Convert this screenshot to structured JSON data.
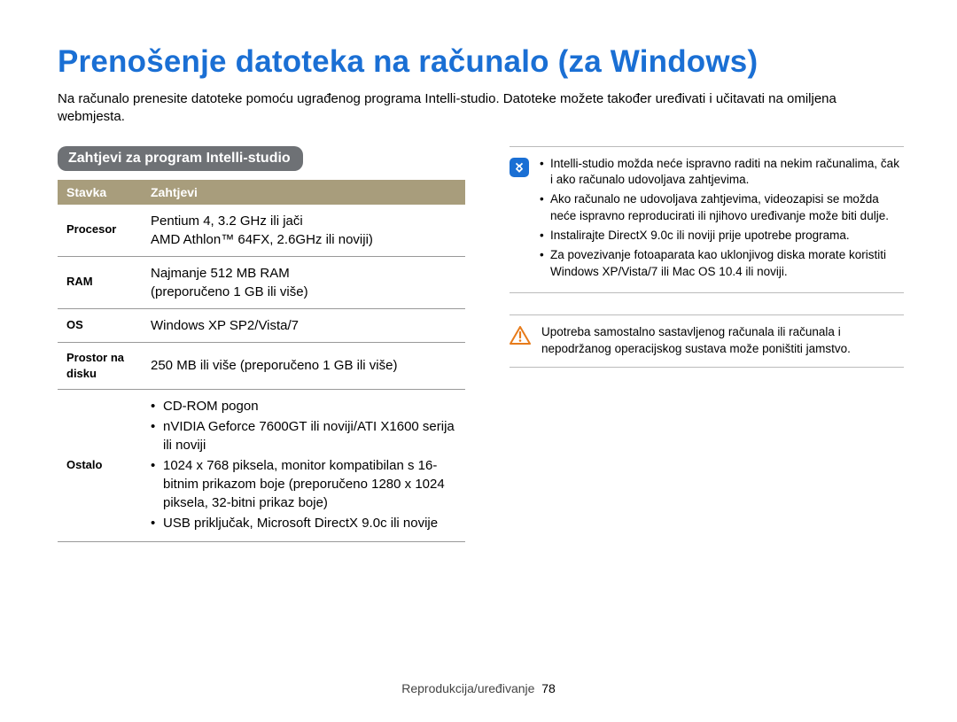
{
  "page": {
    "title": "Prenošenje datoteka na računalo (za Windows)",
    "intro": "Na računalo prenesite datoteke pomoću ugrađenog programa Intelli-studio. Datoteke možete također uređivati i učitavati na omiljena webmjesta."
  },
  "section_heading": "Zahtjevi za program Intelli-studio",
  "table": {
    "head_item": "Stavka",
    "head_req": "Zahtjevi",
    "rows": {
      "procesor": {
        "label": "Procesor",
        "value": "Pentium 4, 3.2 GHz ili jači\nAMD Athlon™ 64FX, 2.6GHz ili noviji)"
      },
      "ram": {
        "label": "RAM",
        "value": "Najmanje 512 MB RAM\n(preporučeno 1 GB ili više)"
      },
      "os": {
        "label": "OS",
        "value": "Windows XP SP2/Vista/7"
      },
      "disk": {
        "label": "Prostor na disku",
        "value": "250 MB ili više (preporučeno 1 GB ili više)"
      },
      "ostalo": {
        "label": "Ostalo",
        "items": [
          "CD-ROM pogon",
          "nVIDIA Geforce 7600GT ili noviji/ATI X1600 serija ili noviji",
          "1024 x 768 piksela, monitor kompatibilan s 16-bitnim prikazom boje (preporučeno 1280 x 1024 piksela, 32-bitni prikaz boje)",
          "USB priključak, Microsoft DirectX 9.0c ili novije"
        ]
      }
    }
  },
  "info_notes": [
    "Intelli-studio možda neće ispravno raditi na nekim računalima, čak i ako računalo udovoljava zahtjevima.",
    "Ako računalo ne udovoljava zahtjevima, videozapisi se možda neće ispravno reproducirati ili njihovo uređivanje može biti dulje.",
    "Instalirajte DirectX 9.0c ili noviji prije upotrebe programa.",
    "Za povezivanje fotoaparata kao uklonjivog diska morate koristiti Windows XP/Vista/7 ili Mac OS 10.4 ili noviji."
  ],
  "warning_text": "Upotreba samostalno sastavljenog računala ili računala i nepodržanog operacijskog sustava može poništiti jamstvo.",
  "footer": {
    "section": "Reprodukcija/uređivanje",
    "page": "78"
  }
}
